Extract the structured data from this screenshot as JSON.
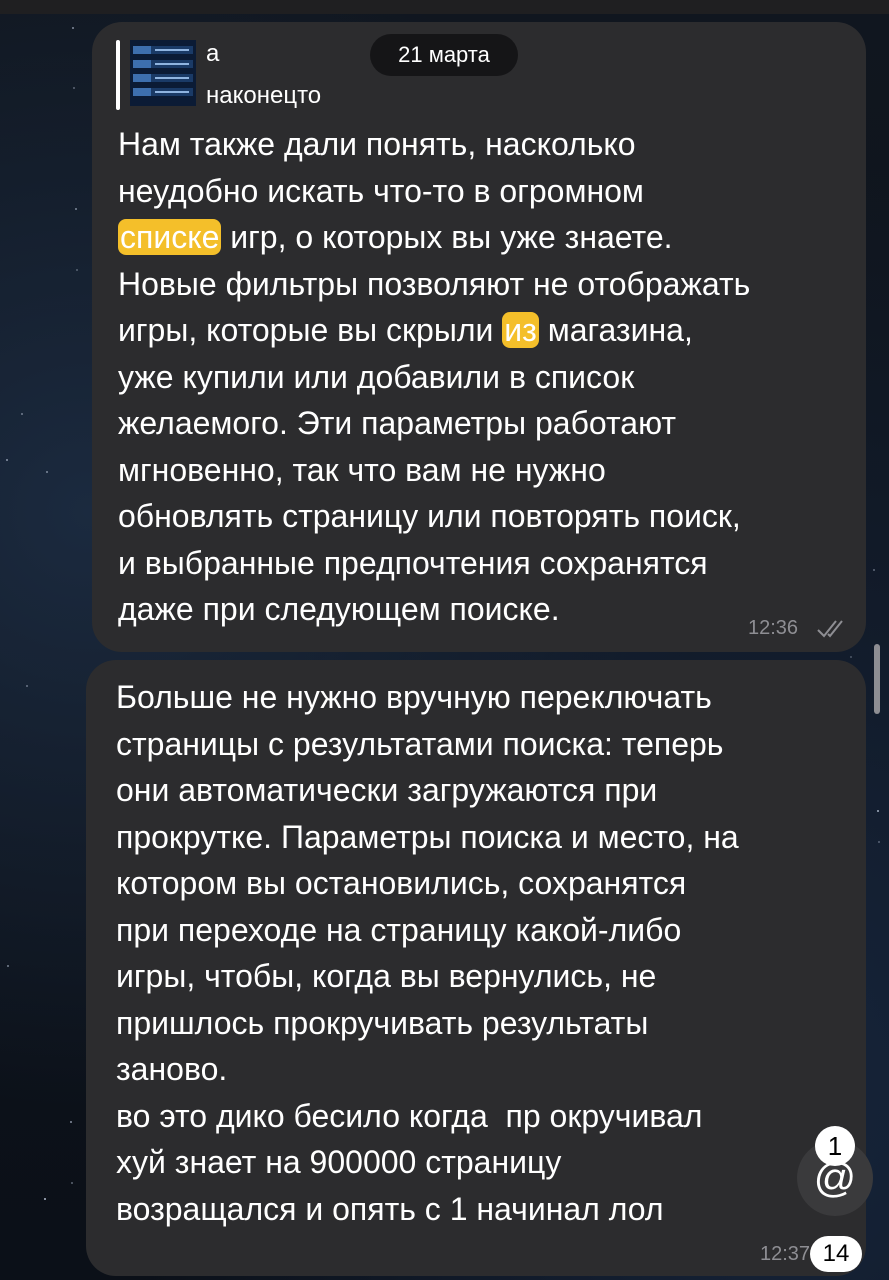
{
  "chat": {
    "date_pill": "21 марта",
    "messages": [
      {
        "reply": {
          "name": "а",
          "text": "наконецто"
        },
        "lines": [
          [
            {
              "t": "Нам также дали понять, насколько"
            }
          ],
          [
            {
              "t": "неудобно искать что-то в огромном"
            }
          ],
          [
            {
              "t": "списке",
              "highlight": true
            },
            {
              "t": " игр, о которых вы уже знаете."
            }
          ],
          [
            {
              "t": "Новые фильтры позволяют не отображать"
            }
          ],
          [
            {
              "t": "игры, которые вы скрыли "
            },
            {
              "t": "из",
              "highlight": true
            },
            {
              "t": " магазина,"
            }
          ],
          [
            {
              "t": "уже купили или добавили в список"
            }
          ],
          [
            {
              "t": "желаемого. Эти параметры работают"
            }
          ],
          [
            {
              "t": "мгновенно, так что вам не нужно"
            }
          ],
          [
            {
              "t": "обновлять страницу или повторять поиск,"
            }
          ],
          [
            {
              "t": "и выбранные предпочтения сохранятся"
            }
          ],
          [
            {
              "t": "даже при следующем поиске."
            }
          ]
        ],
        "time": "12:36",
        "status_icon": "double-check-icon"
      },
      {
        "lines": [
          [
            {
              "t": "Больше не нужно вручную переключать"
            }
          ],
          [
            {
              "t": "страницы с результатами поиска: теперь"
            }
          ],
          [
            {
              "t": "они автоматически загружаются при"
            }
          ],
          [
            {
              "t": "прокрутке. Параметры поиска и место, на"
            }
          ],
          [
            {
              "t": "котором вы остановились, сохранятся"
            }
          ],
          [
            {
              "t": "при переходе на страницу какой-либо"
            }
          ],
          [
            {
              "t": "игры, чтобы, когда вы вернулись, не"
            }
          ],
          [
            {
              "t": "пришлось прокручивать результаты"
            }
          ],
          [
            {
              "t": "заново."
            }
          ],
          [
            {
              "t": "во это дико бесило когда  пр окручивал"
            }
          ],
          [
            {
              "t": "хуй знает на 900000 страницу"
            }
          ],
          [
            {
              "t": "возращался и опять с 1 начинал лол"
            }
          ]
        ],
        "time": "12:37"
      }
    ],
    "mention_button": {
      "icon": "at-sign-icon",
      "glyph": "@",
      "badge": "1"
    },
    "unread_badge": "14"
  },
  "colors": {
    "bubble": "#2c2c2e",
    "highlight": "#f4bf2a",
    "time": "#8e8e93",
    "background": "#0d1119"
  }
}
